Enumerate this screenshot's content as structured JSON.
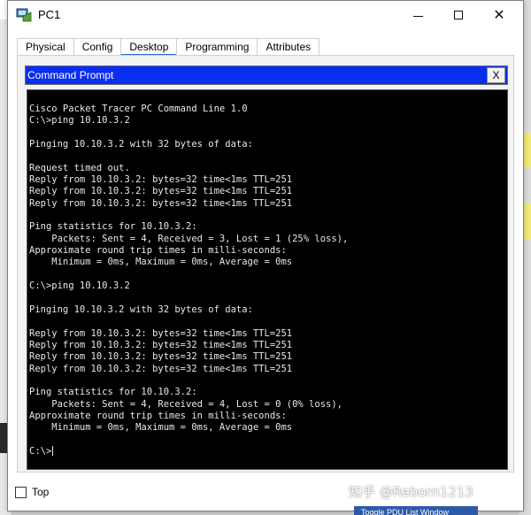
{
  "window": {
    "title": "PC1",
    "controls": {
      "minimize": "minimize",
      "maximize": "maximize",
      "close": "✕"
    }
  },
  "tabs": [
    {
      "label": "Physical",
      "active": false
    },
    {
      "label": "Config",
      "active": false
    },
    {
      "label": "Desktop",
      "active": true
    },
    {
      "label": "Programming",
      "active": false
    },
    {
      "label": "Attributes",
      "active": false
    }
  ],
  "panel": {
    "title": "Command Prompt",
    "close_label": "X",
    "header_color": "#0a2eef"
  },
  "terminal": {
    "lines": [
      "Cisco Packet Tracer PC Command Line 1.0",
      "C:\\>ping 10.10.3.2",
      "",
      "Pinging 10.10.3.2 with 32 bytes of data:",
      "",
      "Request timed out.",
      "Reply from 10.10.3.2: bytes=32 time<1ms TTL=251",
      "Reply from 10.10.3.2: bytes=32 time<1ms TTL=251",
      "Reply from 10.10.3.2: bytes=32 time<1ms TTL=251",
      "",
      "Ping statistics for 10.10.3.2:",
      "    Packets: Sent = 4, Received = 3, Lost = 1 (25% loss),",
      "Approximate round trip times in milli-seconds:",
      "    Minimum = 0ms, Maximum = 0ms, Average = 0ms",
      "",
      "C:\\>ping 10.10.3.2",
      "",
      "Pinging 10.10.3.2 with 32 bytes of data:",
      "",
      "Reply from 10.10.3.2: bytes=32 time<1ms TTL=251",
      "Reply from 10.10.3.2: bytes=32 time<1ms TTL=251",
      "Reply from 10.10.3.2: bytes=32 time<1ms TTL=251",
      "Reply from 10.10.3.2: bytes=32 time<1ms TTL=251",
      "",
      "Ping statistics for 10.10.3.2:",
      "    Packets: Sent = 4, Received = 4, Lost = 0 (0% loss),",
      "Approximate round trip times in milli-seconds:",
      "    Minimum = 0ms, Maximum = 0ms, Average = 0ms",
      "",
      "C:\\>"
    ]
  },
  "footer": {
    "top_label": "Top",
    "top_checked": false
  },
  "watermark": "知乎 @Reborn1213",
  "background": {
    "bottom_tab_label": "Toggle PDU List Window"
  }
}
